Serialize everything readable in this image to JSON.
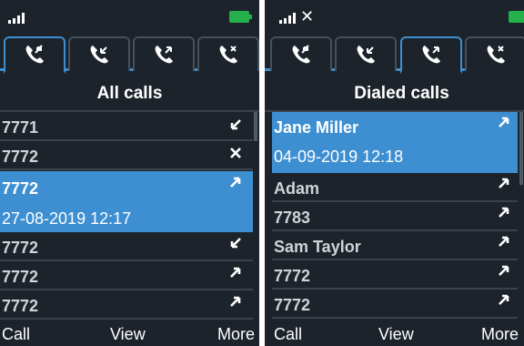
{
  "colors": {
    "accent": "#3d8fd1",
    "background": "#1d232b",
    "battery": "#24b04a",
    "divider": "#3a434d"
  },
  "left": {
    "status": {
      "signal_icon": "signal-bars-icon",
      "battery_icon": "battery-icon"
    },
    "tabs": [
      {
        "icon": "all-calls-icon",
        "active": true
      },
      {
        "icon": "received-calls-icon",
        "active": false
      },
      {
        "icon": "dialed-calls-icon",
        "active": false
      },
      {
        "icon": "missed-calls-icon",
        "active": false
      }
    ],
    "title": "All calls",
    "rows": [
      {
        "label": "7771",
        "icon": "incoming-arrow-icon"
      },
      {
        "label": "7772",
        "icon": "missed-x-icon"
      },
      {
        "label": "7772",
        "datetime": "27-08-2019 12:17",
        "icon": "outgoing-arrow-icon",
        "selected": true
      },
      {
        "label": "7772",
        "icon": "incoming-arrow-icon"
      },
      {
        "label": "7772",
        "icon": "outgoing-arrow-icon"
      },
      {
        "label": "7772",
        "icon": "outgoing-arrow-icon"
      }
    ],
    "softkeys": {
      "left": "Call",
      "center": "View",
      "right": "More"
    }
  },
  "right": {
    "status": {
      "signal_icon": "signal-bars-icon",
      "mute": "✕",
      "battery_icon": "battery-icon"
    },
    "tabs": [
      {
        "icon": "all-calls-icon",
        "active": false
      },
      {
        "icon": "received-calls-icon",
        "active": false
      },
      {
        "icon": "dialed-calls-icon",
        "active": true
      },
      {
        "icon": "missed-calls-icon",
        "active": false
      }
    ],
    "title": "Dialed calls",
    "rows": [
      {
        "label": "Jane Miller",
        "datetime": "04-09-2019 12:18",
        "icon": "outgoing-arrow-icon",
        "selected": true
      },
      {
        "label": "Adam",
        "icon": "outgoing-arrow-icon"
      },
      {
        "label": "7783",
        "icon": "outgoing-arrow-icon"
      },
      {
        "label": "Sam Taylor",
        "icon": "outgoing-arrow-icon"
      },
      {
        "label": "7772",
        "icon": "outgoing-arrow-icon"
      },
      {
        "label": "7772",
        "icon": "outgoing-arrow-icon"
      }
    ],
    "softkeys": {
      "left": "Call",
      "center": "View",
      "right": "More"
    }
  }
}
